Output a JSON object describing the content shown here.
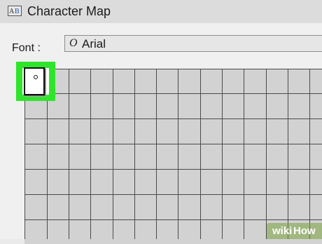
{
  "window": {
    "title": "Character Map",
    "icon": "character-map-app-icon"
  },
  "font": {
    "label": "Font :",
    "type_icon": "O",
    "selected": "Arial"
  },
  "grid": {
    "selected_glyph": "notdef-box-glyph",
    "highlight_color": "#2ee52b"
  },
  "watermark": {
    "wiki": "wiki",
    "how": "How"
  }
}
